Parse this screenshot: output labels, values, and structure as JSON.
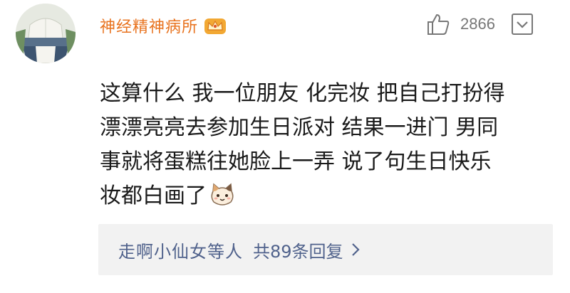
{
  "post": {
    "username": "神经精神病所",
    "like_count": "2866",
    "comment_lines": [
      "这算什么 我一位朋友 化完妆 把自己打扮得",
      "漂漂亮亮去参加生日派对 结果一进门 男同",
      "事就将蛋糕往她脸上一弄 说了句生日快乐",
      "妆都白画了"
    ],
    "reply_summary": {
      "names": "走啊小仙女等人",
      "count": "共89条回复"
    }
  },
  "icons": {
    "avatar": "avatar-image",
    "badge": "vip-crown-badge-icon",
    "like": "thumbs-up-icon",
    "more": "more-options-icon",
    "emoji": "cat-emoji-icon",
    "reply_chevron": "chevron-right-icon"
  },
  "colors": {
    "username": "#e8731f",
    "reply_link": "#50628c",
    "text": "#1a1a1a",
    "muted": "#777777",
    "reply_bg": "#f2f2f2"
  }
}
